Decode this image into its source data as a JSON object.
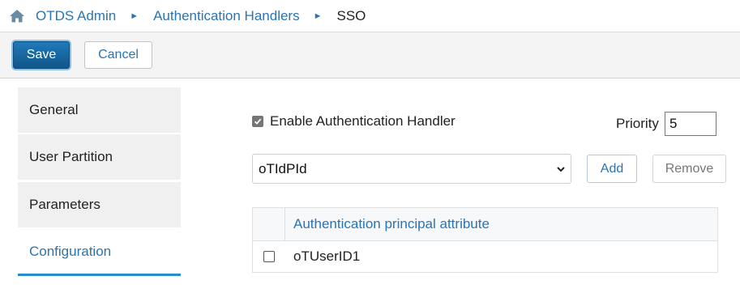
{
  "breadcrumb": {
    "items": [
      "OTDS Admin",
      "Authentication Handlers"
    ],
    "current": "SSO",
    "separator": "►"
  },
  "toolbar": {
    "save_label": "Save",
    "cancel_label": "Cancel"
  },
  "tabs": [
    {
      "label": "General"
    },
    {
      "label": "User Partition"
    },
    {
      "label": "Parameters"
    },
    {
      "label": "Configuration",
      "active": true
    }
  ],
  "config": {
    "enable_label": "Enable Authentication Handler",
    "enable_checked": true,
    "priority_label": "Priority",
    "priority_value": "5",
    "selected_attribute": "oTIdPId",
    "add_label": "Add",
    "remove_label": "Remove"
  },
  "table": {
    "header": "Authentication principal attribute",
    "rows": [
      {
        "value": "oTUserID1",
        "checked": false
      }
    ]
  },
  "colors": {
    "accent": "#2a74b5",
    "save_button": "#1565a0"
  },
  "icons": [
    "home-icon",
    "checkbox-checked-icon",
    "chevron-down-icon",
    "checkbox-icon"
  ]
}
